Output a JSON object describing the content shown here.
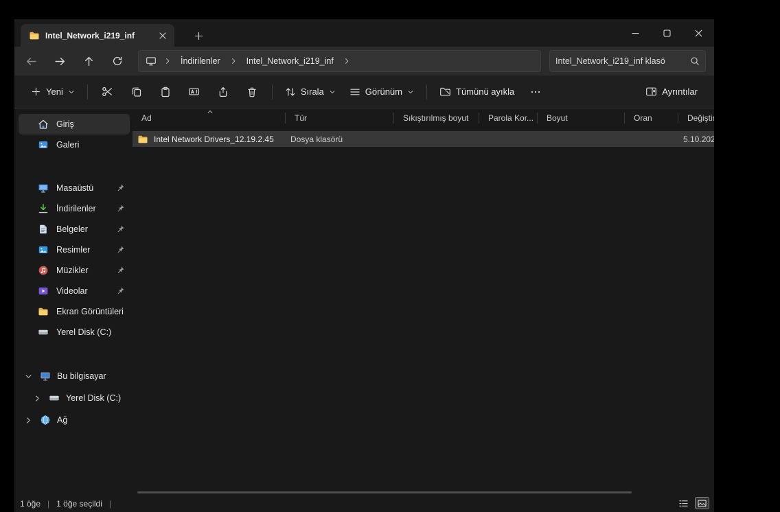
{
  "window": {
    "tab_title": "Intel_Network_i219_inf"
  },
  "nav": {
    "crumbs": [
      "İndirilenler",
      "Intel_Network_i219_inf"
    ],
    "search_value": "Intel_Network_i219_inf klasö"
  },
  "toolbar": {
    "new": "Yeni",
    "sort": "Sırala",
    "view": "Görünüm",
    "extract": "Tümünü ayıkla",
    "details": "Ayrıntılar"
  },
  "list": {
    "columns": {
      "name": "Ad",
      "type": "Tür",
      "compressed": "Sıkıştırılmış boyut",
      "password": "Parola Kor...",
      "size": "Boyut",
      "ratio": "Oran",
      "modified": "Değiştir"
    },
    "rows": [
      {
        "name": "Intel Network Drivers_12.19.2.45",
        "type": "Dosya klasörü",
        "modified": "5.10.202"
      }
    ]
  },
  "sidebar": {
    "home": "Giriş",
    "gallery": "Galeri",
    "pinned": [
      "Masaüstü",
      "İndirilenler",
      "Belgeler",
      "Resimler",
      "Müzikler",
      "Videolar",
      "Ekran Görüntüleri",
      "Yerel Disk (C:)"
    ],
    "tree": {
      "this_pc": "Bu bilgisayar",
      "local_disk": "Yerel Disk (C:)",
      "network": "Ağ"
    }
  },
  "statusbar": {
    "count": "1 öğe",
    "sep": "|",
    "selected": "1 öğe seçildi"
  },
  "colors": {
    "folder_accent": "#f0c24b",
    "selection_row": "#383838"
  }
}
